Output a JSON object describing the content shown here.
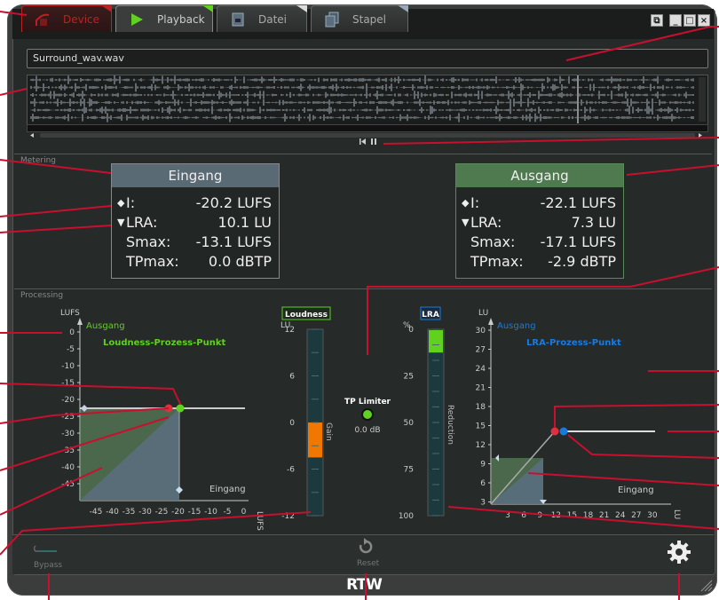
{
  "tabs": [
    {
      "label": "Device"
    },
    {
      "label": "Playback"
    },
    {
      "label": "Datei"
    },
    {
      "label": "Stapel"
    }
  ],
  "window_buttons": [
    "restore-icon",
    "minimize-icon",
    "maximize-icon",
    "close-icon"
  ],
  "file": {
    "name": "Surround_wav.wav"
  },
  "sections": {
    "metering": "Metering",
    "processing": "Processing"
  },
  "input_panel": {
    "title": "Eingang",
    "rows": [
      {
        "label": "I:",
        "value": "-20.2 LUFS"
      },
      {
        "label": "LRA:",
        "value": "10.1 LU"
      },
      {
        "label": "Smax:",
        "value": "-13.1 LUFS"
      },
      {
        "label": "TPmax:",
        "value": "0.0 dBTP"
      }
    ]
  },
  "output_panel": {
    "title": "Ausgang",
    "rows": [
      {
        "label": "I:",
        "value": "-22.1 LUFS"
      },
      {
        "label": "LRA:",
        "value": "7.3 LU"
      },
      {
        "label": "Smax:",
        "value": "-17.1 LUFS"
      },
      {
        "label": "TPmax:",
        "value": "-2.9 dBTP"
      }
    ]
  },
  "loudness_graph": {
    "unit_label": "LUFS",
    "y_axis_label": "Ausgang",
    "x_axis_label": "Eingang",
    "x_unit": "LUFS",
    "point_label": "Loudness-Prozess-Punkt",
    "y_ticks": [
      "0",
      "-5",
      "-10",
      "-15",
      "-20",
      "-25",
      "-30",
      "-35",
      "-40",
      "-45"
    ],
    "x_ticks": [
      "-45",
      "-40",
      "-35",
      "-30",
      "-25",
      "-20",
      "-15",
      "-10",
      "-5",
      "0"
    ]
  },
  "loudness_meter": {
    "badge": "Loudness",
    "unit": "LU",
    "ticks": [
      "12",
      "6",
      "0",
      "-6",
      "-12"
    ],
    "bar_label": "Gain",
    "bar_from": 0,
    "bar_to": -4.5
  },
  "tp_limiter": {
    "label": "TP Limiter",
    "value": "0.0 dB"
  },
  "lra_meter": {
    "badge": "LRA",
    "unit": "%",
    "ticks": [
      "0",
      "25",
      "50",
      "75",
      "100"
    ],
    "bar_label": "Reduction",
    "bar_value": 12
  },
  "lra_graph": {
    "unit_label": "LU",
    "y_axis_label": "Ausgang",
    "x_axis_label": "Eingang",
    "x_unit": "LU",
    "point_label": "LRA-Prozess-Punkt",
    "y_ticks": [
      "30",
      "27",
      "24",
      "21",
      "18",
      "15",
      "12",
      "9",
      "6",
      "3"
    ],
    "x_ticks": [
      "3",
      "6",
      "9",
      "12",
      "15",
      "18",
      "21",
      "24",
      "27",
      "30"
    ]
  },
  "footer": {
    "bypass": "Bypass",
    "reset": "Reset"
  },
  "brand": "RTW",
  "colors": {
    "accent_green": "#5fd11e",
    "accent_blue": "#1a7ae0",
    "annotation_red": "#c8102e"
  }
}
